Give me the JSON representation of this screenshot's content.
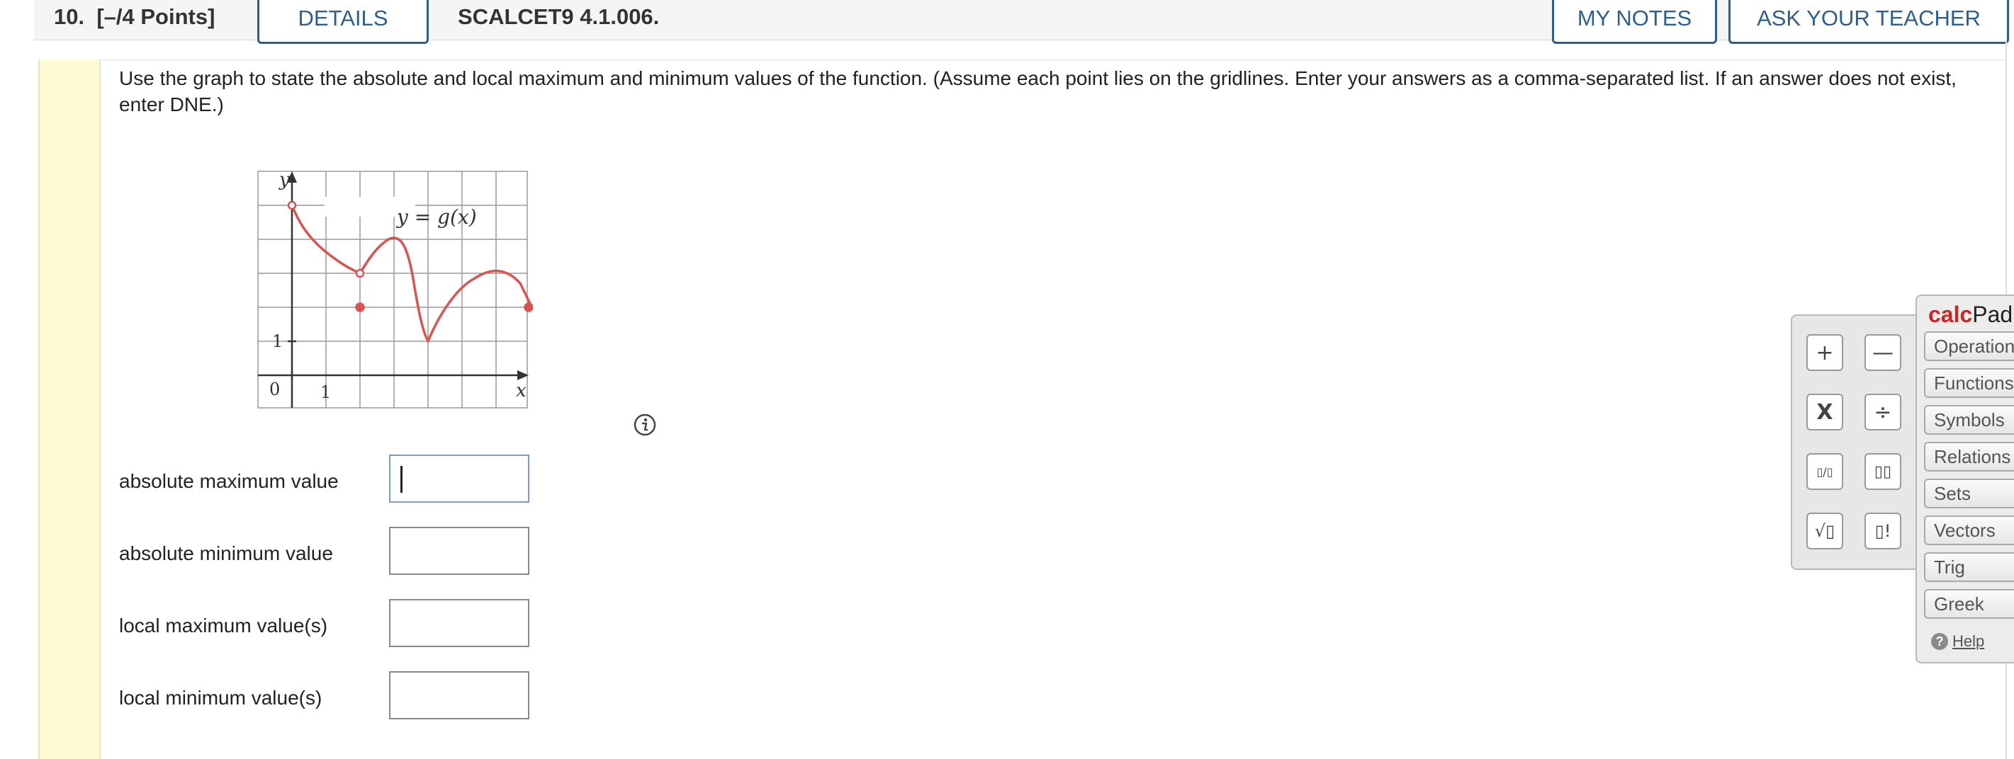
{
  "header": {
    "number": "10.",
    "points": "[–/4 Points]",
    "details_label": "DETAILS",
    "code": "SCALCET9 4.1.006.",
    "my_notes_label": "MY NOTES",
    "ask_teacher_label": "ASK YOUR TEACHER"
  },
  "question": {
    "instructions": "Use the graph to state the absolute and local maximum and minimum values of the function. (Assume each point lies on the gridlines. Enter your answers as a comma-separated list. If an answer does not exist, enter DNE.)"
  },
  "graph": {
    "function_label": "y = g(x)",
    "y_axis_label": "y",
    "x_axis_label": "x",
    "origin_label": "0",
    "x_tick_label": "1",
    "y_tick_label": "1",
    "curve_color": "#d9534f"
  },
  "answers": [
    {
      "label": "absolute maximum value",
      "value": ""
    },
    {
      "label": "absolute minimum value",
      "value": ""
    },
    {
      "label": "local maximum value(s)",
      "value": ""
    },
    {
      "label": "local minimum value(s)",
      "value": ""
    }
  ],
  "keypad": {
    "keys": [
      "+",
      "—",
      "X",
      "÷",
      "▯/▯",
      "▯▯",
      "√▯",
      "▯!"
    ]
  },
  "calcpad": {
    "title_part1": "calc",
    "title_part2": "Pad",
    "tabs": [
      "Operations",
      "Functions",
      "Symbols",
      "Relations",
      "Sets",
      "Vectors",
      "Trig",
      "Greek"
    ],
    "help_label": "Help"
  }
}
